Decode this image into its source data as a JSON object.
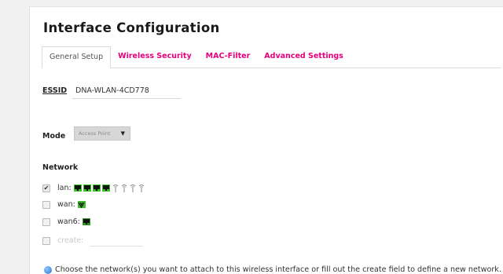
{
  "page": {
    "title": "Interface Configuration"
  },
  "tabs": [
    {
      "label": "General Setup",
      "active": true
    },
    {
      "label": "Wireless Security",
      "active": false
    },
    {
      "label": "MAC-Filter",
      "active": false
    },
    {
      "label": "Advanced Settings",
      "active": false
    }
  ],
  "essid": {
    "label": "ESSID",
    "value": "DNA-WLAN-4CD778"
  },
  "mode": {
    "label": "Mode",
    "selected": "Access Point"
  },
  "network": {
    "label": "Network",
    "options": [
      {
        "name": "lan:",
        "checked": true
      },
      {
        "name": "wan:",
        "checked": false
      },
      {
        "name": "wan6:",
        "checked": false
      },
      {
        "name": "create:",
        "checked": false
      }
    ]
  },
  "hint": {
    "text": "Choose the network(s) you want to attach to this wireless interface or fill out the create field to define a new network."
  },
  "colors": {
    "accent": "#e6007e",
    "iface_green": "#3fbf2b",
    "info_blue": "#2a76d2"
  }
}
